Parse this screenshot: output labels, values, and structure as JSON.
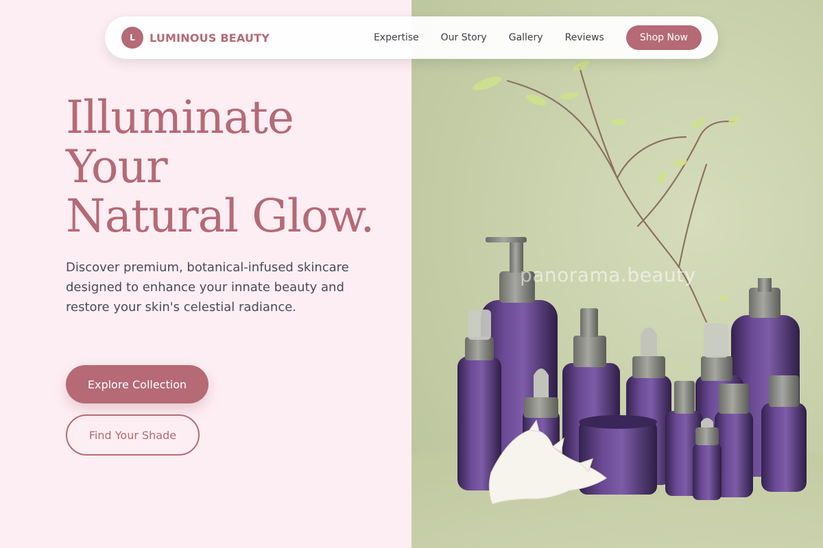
{
  "brand": {
    "initial": "L",
    "name": "LUMINOUS BEAUTY"
  },
  "nav": {
    "links": [
      "Expertise",
      "Our Story",
      "Gallery",
      "Reviews"
    ],
    "cta": "Shop Now"
  },
  "hero": {
    "headline": [
      "Illuminate",
      "Your",
      "Natural Glow."
    ],
    "description": "Discover premium, botanical-infused skincare designed to enhance your innate beauty and restore your skin's celestial radiance.",
    "primary_cta": "Explore Collection",
    "secondary_cta": "Find Your Shade"
  },
  "image": {
    "watermark": "panorama.beauty"
  },
  "colors": {
    "accent": "#b56a76",
    "panel": "#fdeef3",
    "backdrop": "#c6cea8",
    "bottle": "#5b3d80"
  }
}
